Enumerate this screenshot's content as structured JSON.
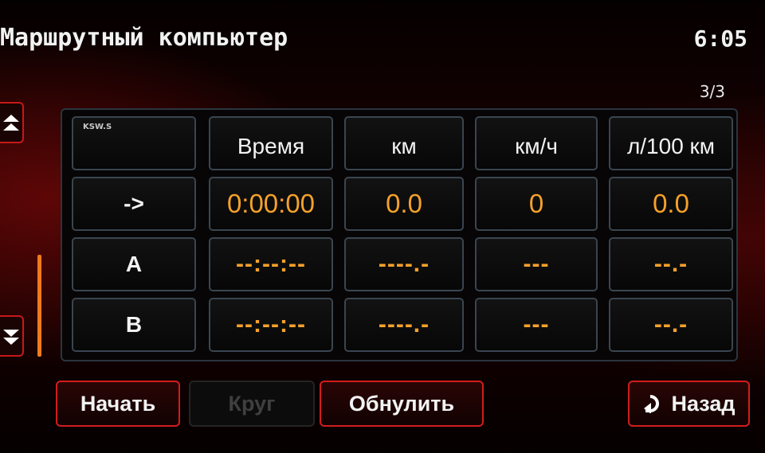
{
  "header": {
    "title": "Маршрутный компьютер",
    "clock": "6:05",
    "page_indicator": "3/3"
  },
  "scroll": {
    "up_icon": "double-chevron-up-icon",
    "down_icon": "double-chevron-down-icon"
  },
  "table": {
    "watermark": "KSW.S",
    "columns": [
      "Время",
      "км",
      "км/ч",
      "л/100 км"
    ],
    "rows": [
      {
        "label": "->",
        "values": [
          "0:00:00",
          "0.0",
          "0",
          "0.0"
        ]
      },
      {
        "label": "A",
        "values": [
          "--:--:--",
          "----.-",
          "---",
          "--.-"
        ]
      },
      {
        "label": "B",
        "values": [
          "--:--:--",
          "----.-",
          "---",
          "--.-"
        ]
      }
    ]
  },
  "buttons": {
    "start": "Начать",
    "lap": "Круг",
    "reset": "Обнулить",
    "back": "Назад",
    "back_icon": "return-arrow-icon"
  },
  "colors": {
    "accent_red": "#d21c1c",
    "value_orange": "#f5a12a",
    "text_white": "#f2f2f2"
  }
}
